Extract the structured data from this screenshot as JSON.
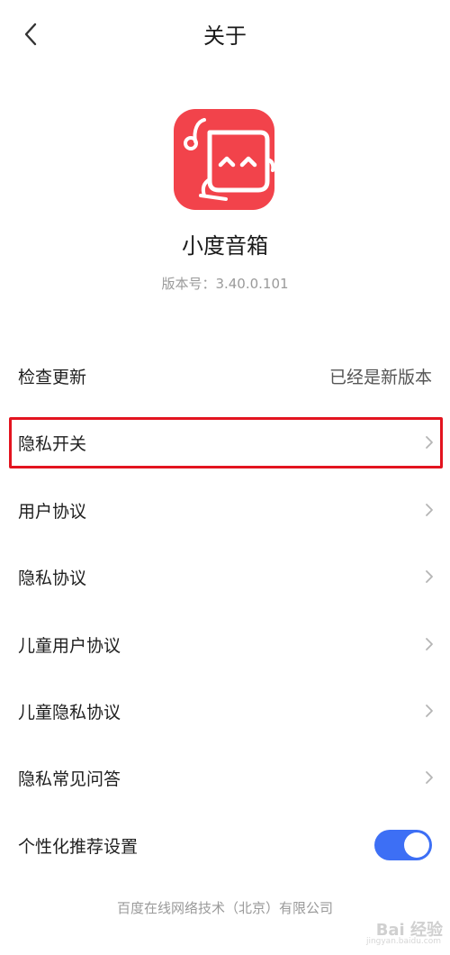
{
  "header": {
    "title": "关于"
  },
  "app": {
    "name": "小度音箱",
    "version": "版本号：3.40.0.101"
  },
  "settings": {
    "check_update": {
      "label": "检查更新",
      "value": "已经是新版本"
    },
    "privacy_switch": {
      "label": "隐私开关"
    },
    "user_agreement": {
      "label": "用户协议"
    },
    "privacy_agreement": {
      "label": "隐私协议"
    },
    "child_user_agreement": {
      "label": "儿童用户协议"
    },
    "child_privacy_agreement": {
      "label": "儿童隐私协议"
    },
    "privacy_faq": {
      "label": "隐私常见问答"
    },
    "personalized_recommendation": {
      "label": "个性化推荐设置",
      "toggle_on": true
    }
  },
  "footer": {
    "company": "百度在线网络技术（北京）有限公司"
  },
  "watermark": {
    "text": "Bai 经验",
    "subtext": "jingyan.baidu.com"
  },
  "colors": {
    "logo_red": "#f2434b",
    "highlight_red": "#e3141f",
    "toggle_blue": "#3d6ff5"
  }
}
